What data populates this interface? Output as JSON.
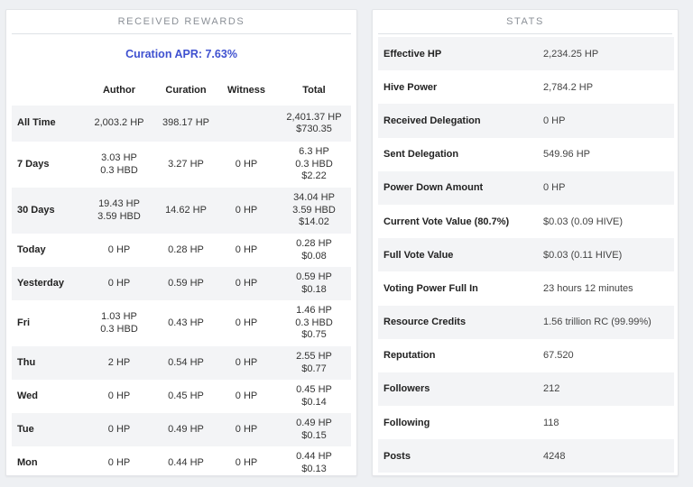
{
  "rewards": {
    "title": "RECEIVED REWARDS",
    "apr": "Curation APR: 7.63%",
    "headers": {
      "period": "",
      "author": "Author",
      "curation": "Curation",
      "witness": "Witness",
      "total": "Total"
    },
    "rows": [
      {
        "label": "All Time",
        "author": [
          "2,003.2 HP"
        ],
        "curation": [
          "398.17 HP"
        ],
        "witness": [
          ""
        ],
        "total": [
          "2,401.37 HP",
          "$730.35"
        ]
      },
      {
        "label": "7 Days",
        "author": [
          "3.03 HP",
          "0.3 HBD"
        ],
        "curation": [
          "3.27 HP"
        ],
        "witness": [
          "0 HP"
        ],
        "total": [
          "6.3 HP",
          "0.3 HBD",
          "$2.22"
        ]
      },
      {
        "label": "30 Days",
        "author": [
          "19.43 HP",
          "3.59 HBD"
        ],
        "curation": [
          "14.62 HP"
        ],
        "witness": [
          "0 HP"
        ],
        "total": [
          "34.04 HP",
          "3.59 HBD",
          "$14.02"
        ]
      },
      {
        "label": "Today",
        "author": [
          "0 HP"
        ],
        "curation": [
          "0.28 HP"
        ],
        "witness": [
          "0 HP"
        ],
        "total": [
          "0.28 HP",
          "$0.08"
        ]
      },
      {
        "label": "Yesterday",
        "author": [
          "0 HP"
        ],
        "curation": [
          "0.59 HP"
        ],
        "witness": [
          "0 HP"
        ],
        "total": [
          "0.59 HP",
          "$0.18"
        ]
      },
      {
        "label": "Fri",
        "author": [
          "1.03 HP",
          "0.3 HBD"
        ],
        "curation": [
          "0.43 HP"
        ],
        "witness": [
          "0 HP"
        ],
        "total": [
          "1.46 HP",
          "0.3 HBD",
          "$0.75"
        ]
      },
      {
        "label": "Thu",
        "author": [
          "2 HP"
        ],
        "curation": [
          "0.54 HP"
        ],
        "witness": [
          "0 HP"
        ],
        "total": [
          "2.55 HP",
          "$0.77"
        ]
      },
      {
        "label": "Wed",
        "author": [
          "0 HP"
        ],
        "curation": [
          "0.45 HP"
        ],
        "witness": [
          "0 HP"
        ],
        "total": [
          "0.45 HP",
          "$0.14"
        ]
      },
      {
        "label": "Tue",
        "author": [
          "0 HP"
        ],
        "curation": [
          "0.49 HP"
        ],
        "witness": [
          "0 HP"
        ],
        "total": [
          "0.49 HP",
          "$0.15"
        ]
      },
      {
        "label": "Mon",
        "author": [
          "0 HP"
        ],
        "curation": [
          "0.44 HP"
        ],
        "witness": [
          "0 HP"
        ],
        "total": [
          "0.44 HP",
          "$0.13"
        ]
      }
    ]
  },
  "stats": {
    "title": "STATS",
    "rows": [
      {
        "label": "Effective HP",
        "value": "2,234.25 HP"
      },
      {
        "label": "Hive Power",
        "value": "2,784.2 HP"
      },
      {
        "label": "Received Delegation",
        "value": "0 HP"
      },
      {
        "label": "Sent Delegation",
        "value": "549.96 HP"
      },
      {
        "label": "Power Down Amount",
        "value": "0 HP"
      },
      {
        "label": "Current Vote Value (80.7%)",
        "value": "$0.03 (0.09 HIVE)"
      },
      {
        "label": "Full Vote Value",
        "value": "$0.03 (0.11 HIVE)"
      },
      {
        "label": "Voting Power Full In",
        "value": "23 hours 12 minutes"
      },
      {
        "label": "Resource Credits",
        "value": "1.56 trillion RC (99.99%)"
      },
      {
        "label": "Reputation",
        "value": "67.520"
      },
      {
        "label": "Followers",
        "value": "212"
      },
      {
        "label": "Following",
        "value": "118"
      },
      {
        "label": "Posts",
        "value": "4248"
      }
    ]
  },
  "colors": {
    "accent": "#3f51d0",
    "stripe": "#f3f4f6",
    "page_bg": "#eef0f3"
  }
}
